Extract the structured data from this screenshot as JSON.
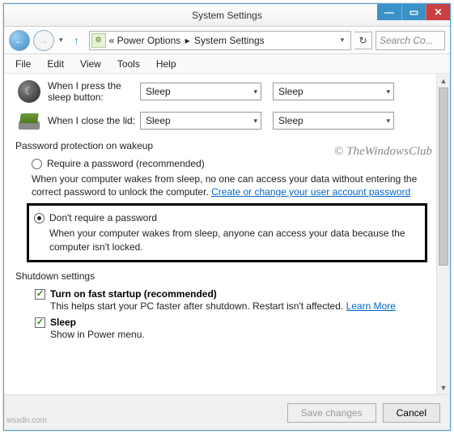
{
  "window": {
    "title": "System Settings"
  },
  "nav": {
    "breadcrumb_prefix": "«",
    "path1": "Power Options",
    "path2": "System Settings",
    "search_placeholder": "Search Co..."
  },
  "menu": {
    "file": "File",
    "edit": "Edit",
    "view": "View",
    "tools": "Tools",
    "help": "Help"
  },
  "rows": {
    "sleep_label": "When I press the sleep button:",
    "lid_label": "When I close the lid:",
    "sleep_value": "Sleep"
  },
  "section_password": {
    "title": "Password protection on wakeup",
    "opt1_label": "Require a password (recommended)",
    "opt1_desc_a": "When your computer wakes from sleep, no one can access your data without entering the correct password to unlock the computer. ",
    "opt1_link": "Create or change your user account password",
    "opt2_label": "Don't require a password",
    "opt2_desc": "When your computer wakes from sleep, anyone can access your data because the computer isn't locked."
  },
  "section_shutdown": {
    "title": "Shutdown settings",
    "fast_label": "Turn on fast startup (recommended)",
    "fast_desc_a": "This helps start your PC faster after shutdown. Restart isn't affected. ",
    "fast_link": "Learn More",
    "sleep_label": "Sleep",
    "sleep_desc": "Show in Power menu."
  },
  "footer": {
    "save": "Save changes",
    "cancel": "Cancel"
  },
  "watermark": "© TheWindowsClub",
  "credit": "wsxdn.com"
}
